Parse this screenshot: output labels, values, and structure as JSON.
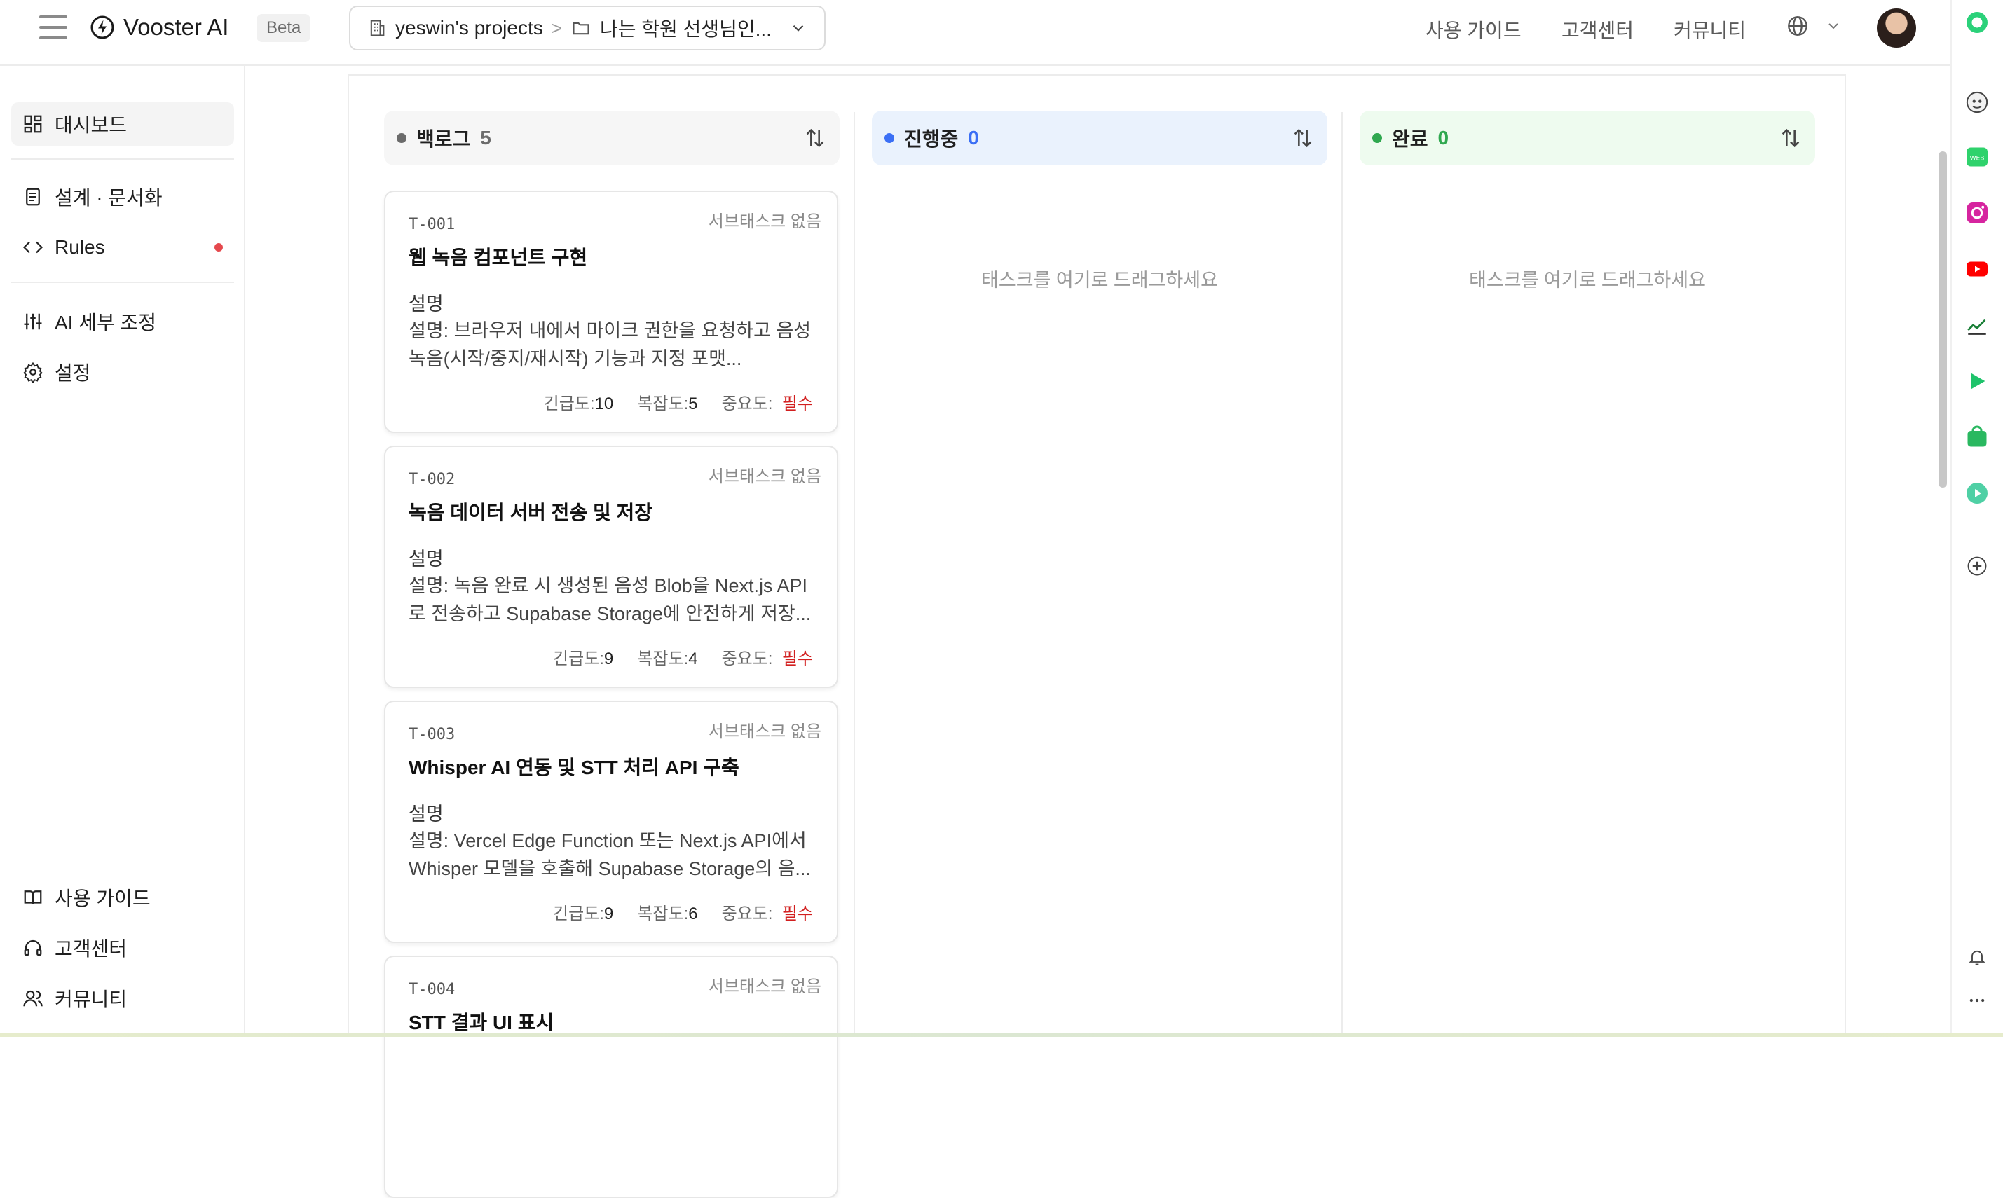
{
  "app": {
    "name": "Vooster AI",
    "badge": "Beta"
  },
  "project": {
    "workspace": "yeswin's projects",
    "separator": ">",
    "name": "나는 학원 선생님인..."
  },
  "top_nav": {
    "guide": "사용 가이드",
    "support": "고객센터",
    "community": "커뮤니티"
  },
  "sidebar": {
    "items": [
      {
        "label": "대시보드",
        "icon": "dashboard-icon"
      },
      {
        "label": "설계 · 문서화",
        "icon": "document-icon"
      },
      {
        "label": "Rules",
        "icon": "code-icon"
      },
      {
        "label": "AI 세부 조정",
        "icon": "sliders-icon"
      },
      {
        "label": "설정",
        "icon": "gear-icon"
      }
    ],
    "footer": [
      {
        "label": "사용 가이드",
        "icon": "book-icon"
      },
      {
        "label": "고객센터",
        "icon": "headset-icon"
      },
      {
        "label": "커뮤니티",
        "icon": "users-icon"
      }
    ]
  },
  "columns": [
    {
      "title": "백로그",
      "count": "5",
      "color": "#6b6b6b"
    },
    {
      "title": "진행중",
      "count": "0",
      "color": "#3b6ff5"
    },
    {
      "title": "완료",
      "count": "0",
      "color": "#2fa84f"
    }
  ],
  "empty_hint": "태스크를 여기로 드래그하세요",
  "cards": [
    {
      "id": "T-001",
      "subtasks": "서브태스크 없음",
      "title": "웹 녹음 컴포넌트 구현",
      "desc_label": "설명",
      "desc": "설명: 브라우저 내에서 마이크 권한을 요청하고 음성 녹음(시작/중지/재시작) 기능과 지정 포맷...",
      "urgency_label": "긴급도:",
      "urgency": "10",
      "complexity_label": "복잡도:",
      "complexity": "5",
      "importance_label": "중요도:",
      "importance": "필수"
    },
    {
      "id": "T-002",
      "subtasks": "서브태스크 없음",
      "title": "녹음 데이터 서버 전송 및 저장",
      "desc_label": "설명",
      "desc": "설명: 녹음 완료 시 생성된 음성 Blob을 Next.js API로 전송하고 Supabase Storage에 안전하게 저장...",
      "urgency_label": "긴급도:",
      "urgency": "9",
      "complexity_label": "복잡도:",
      "complexity": "4",
      "importance_label": "중요도:",
      "importance": "필수"
    },
    {
      "id": "T-003",
      "subtasks": "서브태스크 없음",
      "title": "Whisper AI 연동 및 STT 처리 API 구축",
      "desc_label": "설명",
      "desc": "설명: Vercel Edge Function 또는 Next.js API에서 Whisper 모델을 호출해 Supabase Storage의 음...",
      "urgency_label": "긴급도:",
      "urgency": "9",
      "complexity_label": "복잡도:",
      "complexity": "6",
      "importance_label": "중요도:",
      "importance": "필수"
    },
    {
      "id": "T-004",
      "subtasks": "서브태스크 없음",
      "title": "STT 결과 UI 표시"
    }
  ],
  "rail_icons": [
    "green-circle-icon",
    "avatar-bot-icon",
    "webtoon-icon",
    "instagram-icon",
    "youtube-icon",
    "chart-icon",
    "play-icon",
    "store-icon",
    "music-icon",
    "plus-icon",
    "bell-icon",
    "more-icon"
  ]
}
